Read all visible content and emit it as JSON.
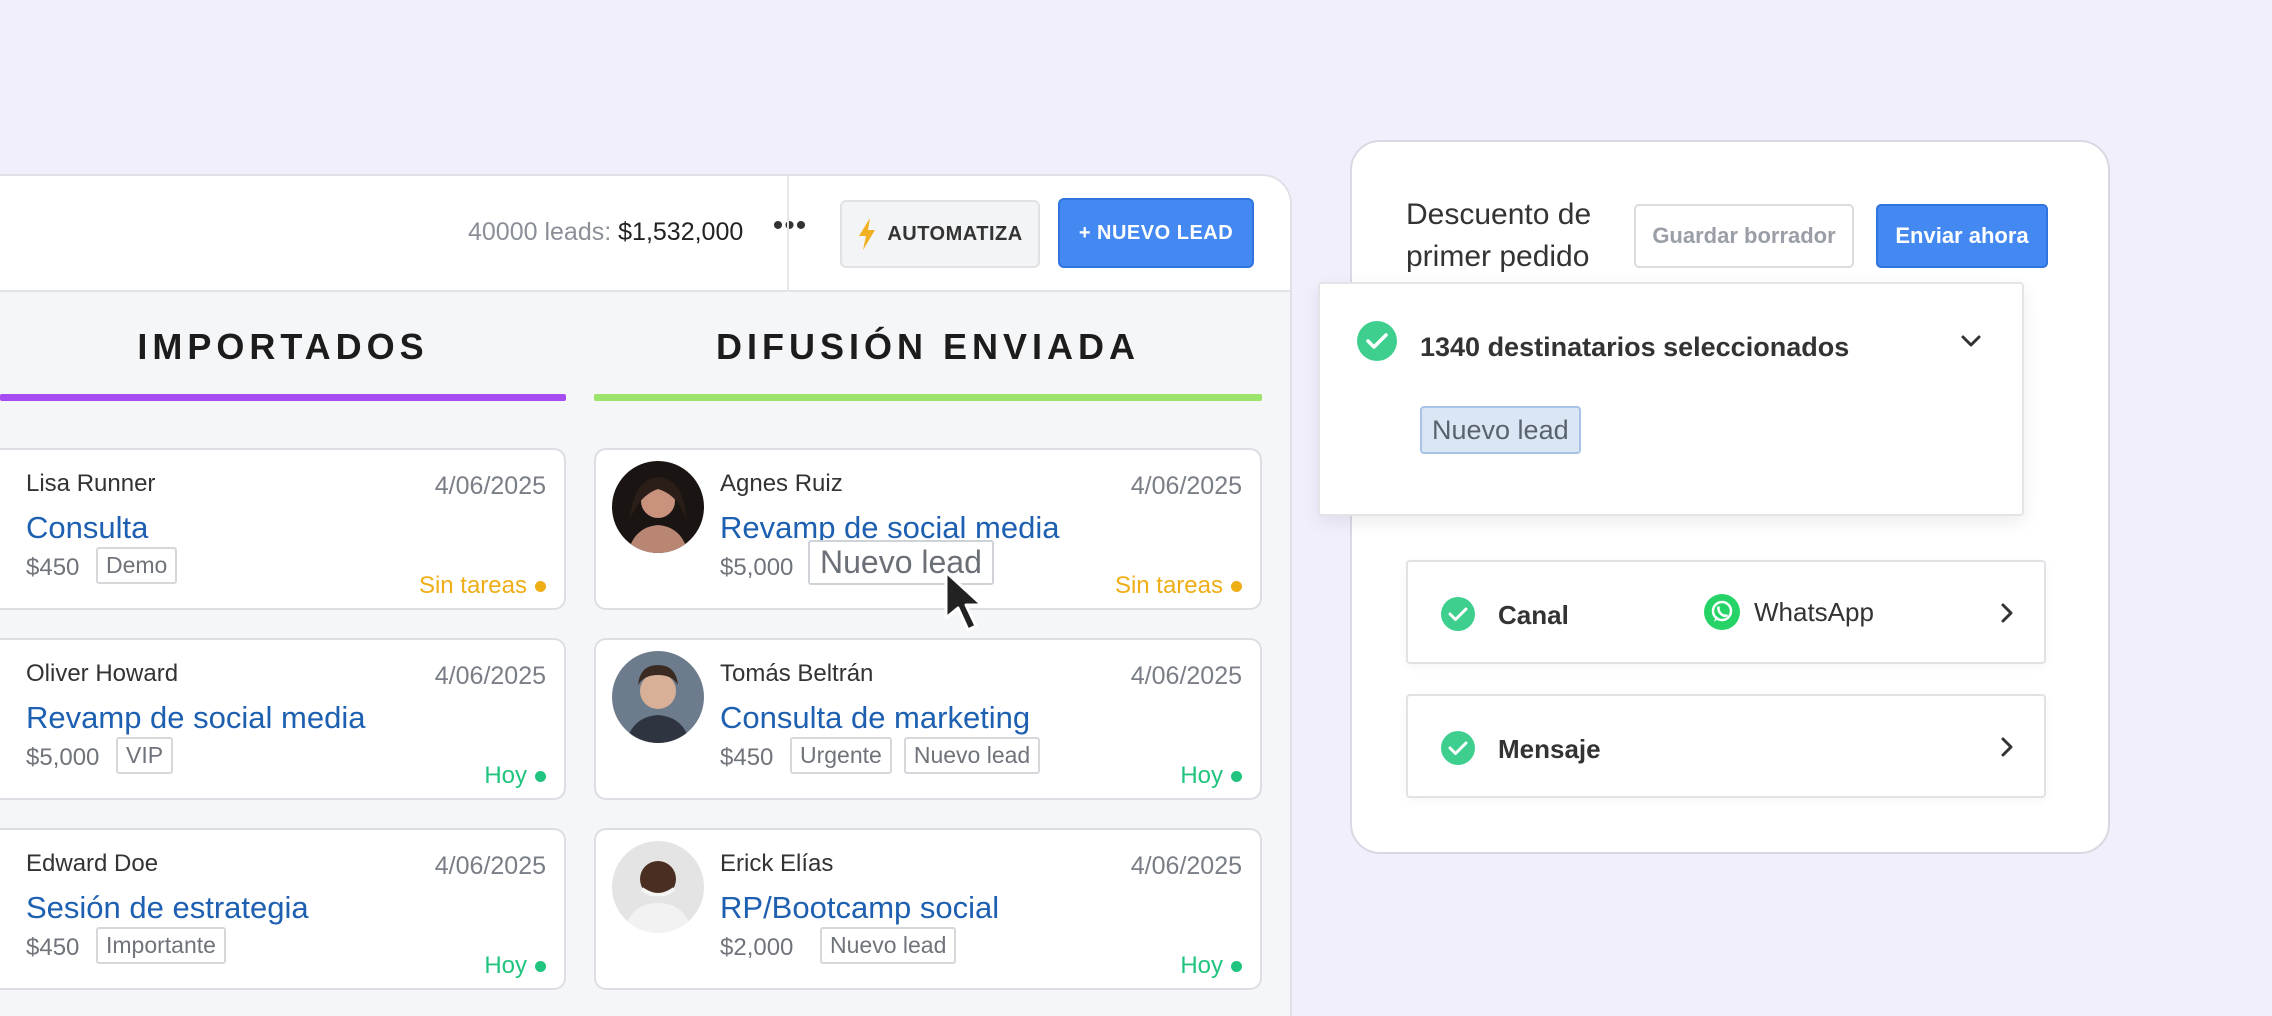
{
  "header": {
    "leads_count": "40000 leads:",
    "leads_total": "$1,532,000",
    "more": "•••",
    "automatiza_label": "AUTOMATIZA",
    "nuevo_lead_label": "+ NUEVO LEAD"
  },
  "columns": [
    {
      "title": "IMPORTADOS",
      "accent": "#a64cf2",
      "cards": [
        {
          "name": "Lisa Runner",
          "date": "4/06/2025",
          "title": "Consulta",
          "price": "$450",
          "tags": [
            "Demo"
          ],
          "status": "Sin tareas",
          "status_color": "orange"
        },
        {
          "name": "Oliver Howard",
          "date": "4/06/2025",
          "title": "Revamp de social media",
          "price": "$5,000",
          "tags": [
            "VIP"
          ],
          "status": "Hoy",
          "status_color": "green"
        },
        {
          "name": "Edward Doe",
          "date": "4/06/2025",
          "title": "Sesión de estrategia",
          "price": "$450",
          "tags": [
            "Importante"
          ],
          "status": "Hoy",
          "status_color": "green"
        }
      ]
    },
    {
      "title": "DIFUSIÓN ENVIADA",
      "accent": "#9be36a",
      "cards": [
        {
          "name": "Agnes Ruiz",
          "date": "4/06/2025",
          "title": "Revamp de social media",
          "price": "$5,000",
          "tags": [
            "Nuevo lead"
          ],
          "status": "Sin tareas",
          "status_color": "orange"
        },
        {
          "name": "Tomás Beltrán",
          "date": "4/06/2025",
          "title": "Consulta de marketing",
          "price": "$450",
          "tags": [
            "Urgente",
            "Nuevo lead"
          ],
          "status": "Hoy",
          "status_color": "green"
        },
        {
          "name": "Erick Elías",
          "date": "4/06/2025",
          "title": "RP/Bootcamp social",
          "price": "$2,000",
          "tags": [
            "Nuevo lead"
          ],
          "status": "Hoy",
          "status_color": "green"
        }
      ]
    }
  ],
  "broadcast": {
    "title": "Descuento de primer pedido",
    "save_draft_label": "Guardar borrador",
    "send_now_label": "Enviar ahora",
    "recipients": "1340 destinatarios seleccionados",
    "recipient_chip": "Nuevo lead",
    "channel_label": "Canal",
    "channel_value": "WhatsApp",
    "message_label": "Mensaje"
  },
  "colors": {
    "primary": "#4489f2",
    "link": "#1d5fb0",
    "success": "#3ecf8e",
    "warning": "#efad16",
    "whatsapp": "#25d366"
  },
  "icons": [
    "lightning-icon",
    "check-circle-icon",
    "chevron-down-icon",
    "chevron-right-icon",
    "whatsapp-icon",
    "mouse-cursor-icon"
  ]
}
